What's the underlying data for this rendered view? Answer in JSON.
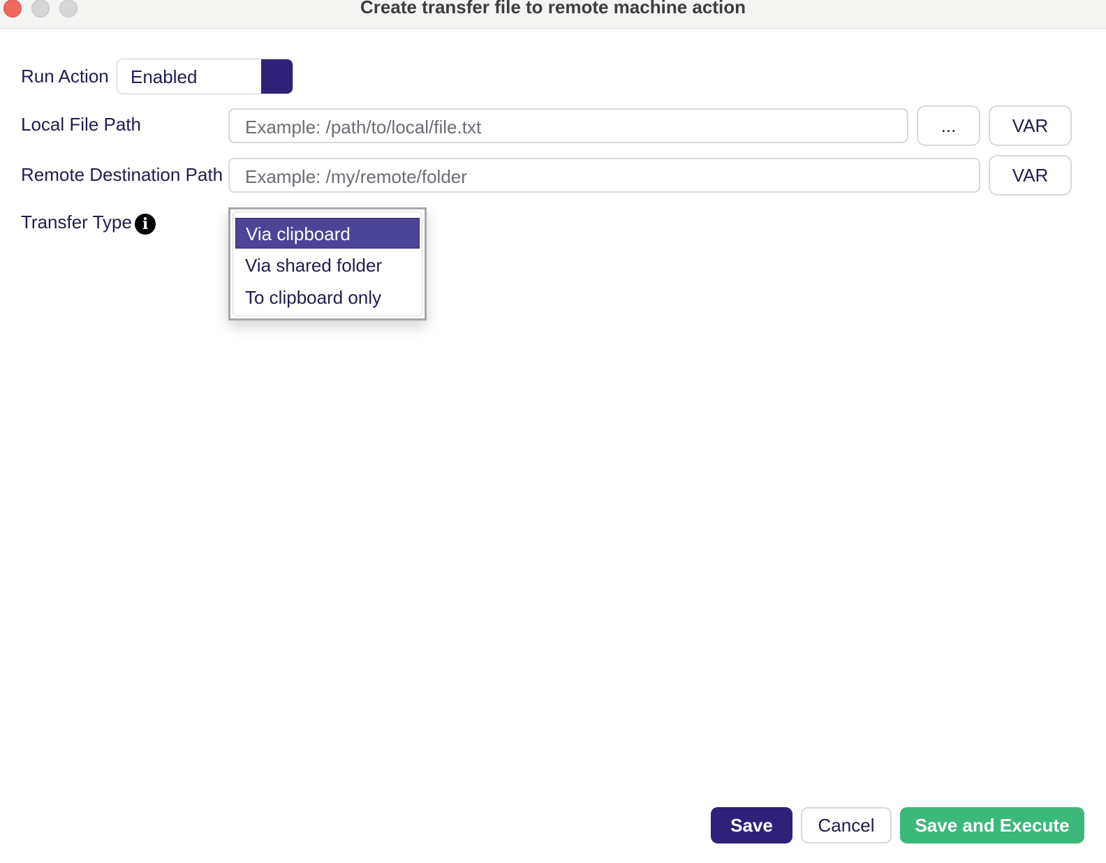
{
  "window": {
    "title": "Create transfer file to remote machine action"
  },
  "run_action": {
    "label": "Run Action",
    "value": "Enabled",
    "accent_color": "#2e2177"
  },
  "local_file_path": {
    "label": "Local File Path",
    "placeholder": "Example: /path/to/local/file.txt",
    "browse_label": "...",
    "var_label": "VAR"
  },
  "remote_destination_path": {
    "label": "Remote Destination Path",
    "placeholder": "Example: /my/remote/folder",
    "var_label": "VAR"
  },
  "transfer_type": {
    "label": "Transfer Type",
    "info_icon": "info-icon",
    "options": [
      "Via clipboard",
      "Via shared folder",
      "To clipboard only"
    ],
    "selected": "Via clipboard"
  },
  "footer": {
    "save_label": "Save",
    "cancel_label": "Cancel",
    "save_execute_label": "Save and Execute",
    "save_color": "#2e2177",
    "save_execute_color": "#3cb878"
  }
}
